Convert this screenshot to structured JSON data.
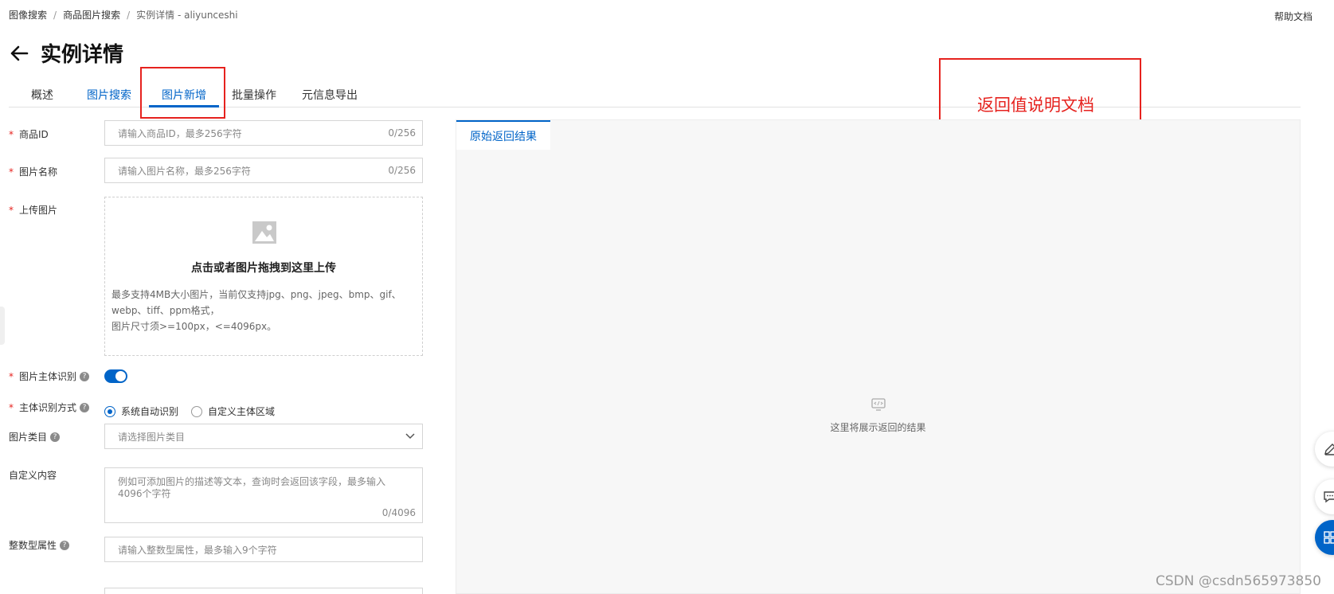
{
  "breadcrumb": {
    "items": [
      "图像搜索",
      "商品图片搜索",
      "实例详情 - aliyunceshi"
    ],
    "separator": "/"
  },
  "header": {
    "help_link": "帮助文档",
    "title": "实例详情"
  },
  "tabs": [
    "概述",
    "图片搜索",
    "图片新增",
    "批量操作",
    "元信息导出"
  ],
  "active_tab": "图片新增",
  "annotation": {
    "doc_note": "返回值说明文档",
    "highlight_color": "#e6221e"
  },
  "form": {
    "product_id": {
      "label": "商品ID",
      "placeholder": "请输入商品ID，最多256字符",
      "count": "0/256"
    },
    "image_name": {
      "label": "图片名称",
      "placeholder": "请输入图片名称，最多256字符",
      "count": "0/256"
    },
    "upload": {
      "label": "上传图片",
      "title": "点击或者图片拖拽到这里上传",
      "desc_line1": "最多支持4MB大小图片，当前仅支持jpg、png、jpeg、bmp、gif、",
      "desc_line2": "webp、tiff、ppm格式，",
      "desc_line3": "图片尺寸须>=100px，<=4096px。"
    },
    "subject_recognition": {
      "label": "图片主体识别",
      "enabled": true
    },
    "recognition_mode": {
      "label": "主体识别方式",
      "options": [
        "系统自动识别",
        "自定义主体区域"
      ],
      "selected": "系统自动识别"
    },
    "category": {
      "label": "图片类目",
      "placeholder": "请选择图片类目"
    },
    "custom_content": {
      "label": "自定义内容",
      "placeholder": "例如可添加图片的描述等文本，查询时会返回该字段，最多输入4096个字符",
      "count": "0/4096"
    },
    "int_attr": {
      "label": "整数型属性",
      "placeholder": "请输入整数型属性，最多输入9个字符"
    }
  },
  "result_panel": {
    "tab": "原始返回结果",
    "empty_text": "这里将展示返回的结果"
  },
  "watermark": "CSDN @csdn565973850",
  "colors": {
    "primary": "#0064c8",
    "required": "#e6221e"
  }
}
